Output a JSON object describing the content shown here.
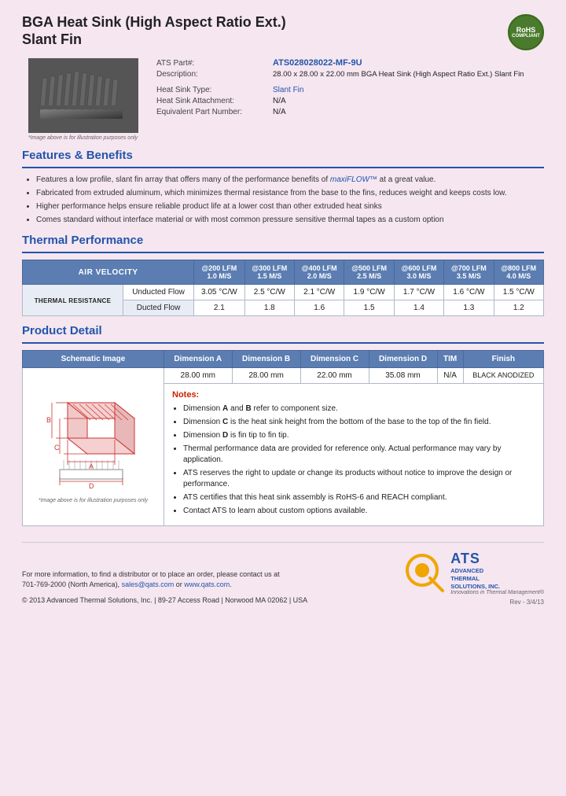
{
  "header": {
    "title_line1": "BGA Heat Sink (High Aspect Ratio Ext.)",
    "title_line2": "Slant Fin",
    "rohs": "RoHS\nCOMPLIANT"
  },
  "product": {
    "part_label": "ATS Part#:",
    "part_number": "ATS028028022-MF-9U",
    "description_label": "Description:",
    "description": "28.00 x 28.00 x 22.00 mm BGA Heat Sink (High Aspect Ratio Ext.) Slant Fin",
    "type_label": "Heat Sink Type:",
    "type_value": "Slant Fin",
    "attachment_label": "Heat Sink Attachment:",
    "attachment_value": "N/A",
    "equiv_label": "Equivalent Part Number:",
    "equiv_value": "N/A",
    "image_caption": "*Image above is for illustration purposes only"
  },
  "features": {
    "section_title": "Features & Benefits",
    "items": [
      "Features a low profile, slant fin array that offers many of the performance benefits of maxiFLOW™ at a great value.",
      "Fabricated from extruded aluminum, which minimizes thermal resistance from the base to the fins, reduces weight and keeps costs low.",
      "Higher performance helps ensure reliable product life at a lower cost than other extruded heat sinks",
      "Comes standard without interface material or with most common pressure sensitive thermal tapes as a custom option"
    ],
    "highlight_text": "maxiFLOW™"
  },
  "thermal_performance": {
    "section_title": "Thermal Performance",
    "header_col1": "AIR VELOCITY",
    "columns": [
      {
        "label": "@200 LFM",
        "sub": "1.0 M/S"
      },
      {
        "label": "@300 LFM",
        "sub": "1.5 M/S"
      },
      {
        "label": "@400 LFM",
        "sub": "2.0 M/S"
      },
      {
        "label": "@500 LFM",
        "sub": "2.5 M/S"
      },
      {
        "label": "@600 LFM",
        "sub": "3.0 M/S"
      },
      {
        "label": "@700 LFM",
        "sub": "3.5 M/S"
      },
      {
        "label": "@800 LFM",
        "sub": "4.0 M/S"
      }
    ],
    "row_label": "THERMAL RESISTANCE",
    "rows": [
      {
        "label": "Unducted Flow",
        "values": [
          "3.05 °C/W",
          "2.5 °C/W",
          "2.1 °C/W",
          "1.9 °C/W",
          "1.7 °C/W",
          "1.6 °C/W",
          "1.5 °C/W"
        ]
      },
      {
        "label": "Ducted Flow",
        "values": [
          "2.1",
          "1.8",
          "1.6",
          "1.5",
          "1.4",
          "1.3",
          "1.2"
        ]
      }
    ]
  },
  "product_detail": {
    "section_title": "Product Detail",
    "table_headers": [
      "Schematic Image",
      "Dimension A",
      "Dimension B",
      "Dimension C",
      "Dimension D",
      "TIM",
      "Finish"
    ],
    "row_values": [
      "28.00 mm",
      "28.00 mm",
      "22.00 mm",
      "35.08 mm",
      "N/A",
      "BLACK ANODIZED"
    ],
    "image_caption": "*Image above is for illustration purposes only",
    "notes_title": "Notes:",
    "notes": [
      "Dimension A and B refer to component size.",
      "Dimension C is the heat sink height from the bottom of the base to the top of the fin field.",
      "Dimension D is fin tip to fin tip.",
      "Thermal performance data are provided for reference only. Actual performance may vary by application.",
      "ATS reserves the right to update or change its products without notice to improve the design or performance.",
      "ATS certifies that this heat sink assembly is RoHS-6 and REACH compliant.",
      "Contact ATS to learn about custom options available."
    ]
  },
  "footer": {
    "contact_text": "For more information, to find a distributor or to place an order, please contact us at\n701-769-2000 (North America),",
    "email": "sales@qats.com",
    "or_text": "or",
    "website": "www.qats.com",
    "copyright": "© 2013 Advanced Thermal Solutions, Inc. | 89-27 Access Road | Norwood MA  02062 | USA",
    "rev": "Rev - 3/4/13",
    "ats_brand": "ATS",
    "ats_full1": "ADVANCED",
    "ats_full2": "THERMAL",
    "ats_full3": "SOLUTIONS, INC.",
    "ats_tagline": "Innovations in Thermal Management®"
  }
}
